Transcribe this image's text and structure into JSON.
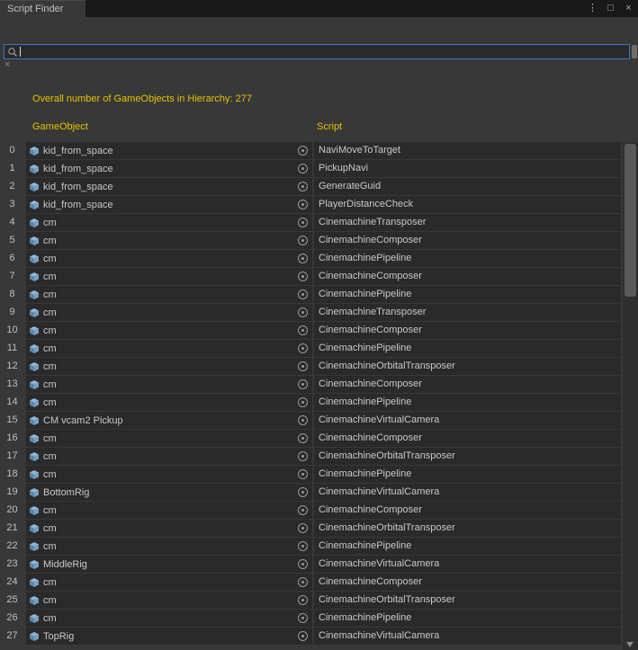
{
  "window": {
    "tab_title": "Script Finder",
    "controls": {
      "menu": "⋮",
      "maximize": "□",
      "close": "×"
    }
  },
  "search": {
    "value": "",
    "placeholder": "",
    "clear_glyph": "×"
  },
  "summary": "Overall number of GameObjects in Hierarchy: 277",
  "table": {
    "columns": [
      "GameObject",
      "Script"
    ],
    "rows": [
      {
        "index": 0,
        "gameobject": "kid_from_space",
        "script": "NaviMoveToTarget"
      },
      {
        "index": 1,
        "gameobject": "kid_from_space",
        "script": "PickupNavi"
      },
      {
        "index": 2,
        "gameobject": "kid_from_space",
        "script": "GenerateGuid"
      },
      {
        "index": 3,
        "gameobject": "kid_from_space",
        "script": "PlayerDistanceCheck"
      },
      {
        "index": 4,
        "gameobject": "cm",
        "script": "CinemachineTransposer"
      },
      {
        "index": 5,
        "gameobject": "cm",
        "script": "CinemachineComposer"
      },
      {
        "index": 6,
        "gameobject": "cm",
        "script": "CinemachinePipeline"
      },
      {
        "index": 7,
        "gameobject": "cm",
        "script": "CinemachineComposer"
      },
      {
        "index": 8,
        "gameobject": "cm",
        "script": "CinemachinePipeline"
      },
      {
        "index": 9,
        "gameobject": "cm",
        "script": "CinemachineTransposer"
      },
      {
        "index": 10,
        "gameobject": "cm",
        "script": "CinemachineComposer"
      },
      {
        "index": 11,
        "gameobject": "cm",
        "script": "CinemachinePipeline"
      },
      {
        "index": 12,
        "gameobject": "cm",
        "script": "CinemachineOrbitalTransposer"
      },
      {
        "index": 13,
        "gameobject": "cm",
        "script": "CinemachineComposer"
      },
      {
        "index": 14,
        "gameobject": "cm",
        "script": "CinemachinePipeline"
      },
      {
        "index": 15,
        "gameobject": "CM vcam2 Pickup",
        "script": "CinemachineVirtualCamera"
      },
      {
        "index": 16,
        "gameobject": "cm",
        "script": "CinemachineComposer"
      },
      {
        "index": 17,
        "gameobject": "cm",
        "script": "CinemachineOrbitalTransposer"
      },
      {
        "index": 18,
        "gameobject": "cm",
        "script": "CinemachinePipeline"
      },
      {
        "index": 19,
        "gameobject": "BottomRig",
        "script": "CinemachineVirtualCamera"
      },
      {
        "index": 20,
        "gameobject": "cm",
        "script": "CinemachineComposer"
      },
      {
        "index": 21,
        "gameobject": "cm",
        "script": "CinemachineOrbitalTransposer"
      },
      {
        "index": 22,
        "gameobject": "cm",
        "script": "CinemachinePipeline"
      },
      {
        "index": 23,
        "gameobject": "MiddleRig",
        "script": "CinemachineVirtualCamera"
      },
      {
        "index": 24,
        "gameobject": "cm",
        "script": "CinemachineComposer"
      },
      {
        "index": 25,
        "gameobject": "cm",
        "script": "CinemachineOrbitalTransposer"
      },
      {
        "index": 26,
        "gameobject": "cm",
        "script": "CinemachinePipeline"
      },
      {
        "index": 27,
        "gameobject": "TopRig",
        "script": "CinemachineVirtualCamera"
      }
    ]
  },
  "colors": {
    "accent_yellow": "#E6C300",
    "focus_blue": "#3A79BB",
    "cell_bg": "#2A2A2A",
    "window_bg": "#383838"
  }
}
